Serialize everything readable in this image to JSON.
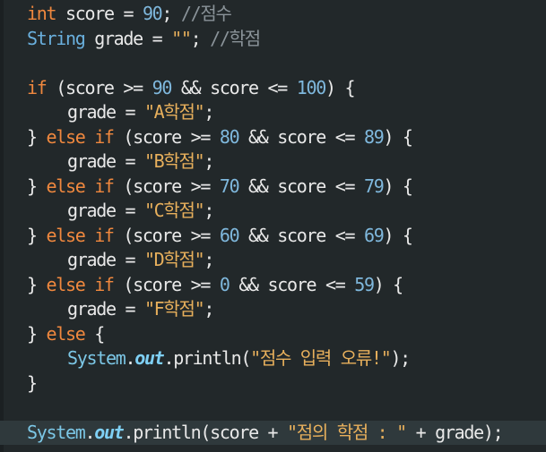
{
  "code": {
    "lines": [
      {
        "indent": 0,
        "tokens": [
          {
            "t": "kw",
            "v": "int"
          },
          {
            "t": "op",
            "v": " "
          },
          {
            "t": "var",
            "v": "score"
          },
          {
            "t": "op",
            "v": " = "
          },
          {
            "t": "num",
            "v": "90"
          },
          {
            "t": "op",
            "v": "; "
          },
          {
            "t": "cmt",
            "v": "//점수"
          }
        ]
      },
      {
        "indent": 0,
        "tokens": [
          {
            "t": "type",
            "v": "String"
          },
          {
            "t": "op",
            "v": " "
          },
          {
            "t": "var",
            "v": "grade"
          },
          {
            "t": "op",
            "v": " = "
          },
          {
            "t": "str",
            "v": "\"\""
          },
          {
            "t": "op",
            "v": "; "
          },
          {
            "t": "cmt",
            "v": "//학점"
          }
        ]
      },
      {
        "indent": 0,
        "tokens": []
      },
      {
        "indent": 0,
        "tokens": [
          {
            "t": "kw",
            "v": "if"
          },
          {
            "t": "op",
            "v": " (score >= "
          },
          {
            "t": "num",
            "v": "90"
          },
          {
            "t": "op",
            "v": " && score <= "
          },
          {
            "t": "num",
            "v": "100"
          },
          {
            "t": "op",
            "v": ") {"
          }
        ]
      },
      {
        "indent": 1,
        "tokens": [
          {
            "t": "var",
            "v": "grade = "
          },
          {
            "t": "str",
            "v": "\"A학점\""
          },
          {
            "t": "op",
            "v": ";"
          }
        ]
      },
      {
        "indent": 0,
        "tokens": [
          {
            "t": "op",
            "v": "} "
          },
          {
            "t": "kw",
            "v": "else if"
          },
          {
            "t": "op",
            "v": " (score >= "
          },
          {
            "t": "num",
            "v": "80"
          },
          {
            "t": "op",
            "v": " && score <= "
          },
          {
            "t": "num",
            "v": "89"
          },
          {
            "t": "op",
            "v": ") {"
          }
        ]
      },
      {
        "indent": 1,
        "tokens": [
          {
            "t": "var",
            "v": "grade = "
          },
          {
            "t": "str",
            "v": "\"B학점\""
          },
          {
            "t": "op",
            "v": ";"
          }
        ]
      },
      {
        "indent": 0,
        "tokens": [
          {
            "t": "op",
            "v": "} "
          },
          {
            "t": "kw",
            "v": "else if"
          },
          {
            "t": "op",
            "v": " (score >= "
          },
          {
            "t": "num",
            "v": "70"
          },
          {
            "t": "op",
            "v": " && score <= "
          },
          {
            "t": "num",
            "v": "79"
          },
          {
            "t": "op",
            "v": ") {"
          }
        ]
      },
      {
        "indent": 1,
        "tokens": [
          {
            "t": "var",
            "v": "grade = "
          },
          {
            "t": "str",
            "v": "\"C학점\""
          },
          {
            "t": "op",
            "v": ";"
          }
        ]
      },
      {
        "indent": 0,
        "tokens": [
          {
            "t": "op",
            "v": "} "
          },
          {
            "t": "kw",
            "v": "else if"
          },
          {
            "t": "op",
            "v": " (score >= "
          },
          {
            "t": "num",
            "v": "60"
          },
          {
            "t": "op",
            "v": " && score <= "
          },
          {
            "t": "num",
            "v": "69"
          },
          {
            "t": "op",
            "v": ") {"
          }
        ]
      },
      {
        "indent": 1,
        "tokens": [
          {
            "t": "var",
            "v": "grade = "
          },
          {
            "t": "str",
            "v": "\"D학점\""
          },
          {
            "t": "op",
            "v": ";"
          }
        ]
      },
      {
        "indent": 0,
        "tokens": [
          {
            "t": "op",
            "v": "} "
          },
          {
            "t": "kw",
            "v": "else if"
          },
          {
            "t": "op",
            "v": " (score >= "
          },
          {
            "t": "num",
            "v": "0"
          },
          {
            "t": "op",
            "v": " && score <= "
          },
          {
            "t": "num",
            "v": "59"
          },
          {
            "t": "op",
            "v": ") {"
          }
        ]
      },
      {
        "indent": 1,
        "tokens": [
          {
            "t": "var",
            "v": "grade = "
          },
          {
            "t": "str",
            "v": "\"F학점\""
          },
          {
            "t": "op",
            "v": ";"
          }
        ]
      },
      {
        "indent": 0,
        "tokens": [
          {
            "t": "op",
            "v": "} "
          },
          {
            "t": "kw",
            "v": "else"
          },
          {
            "t": "op",
            "v": " {"
          }
        ]
      },
      {
        "indent": 1,
        "tokens": [
          {
            "t": "cls",
            "v": "System"
          },
          {
            "t": "op",
            "v": "."
          },
          {
            "t": "fld",
            "v": "out"
          },
          {
            "t": "op",
            "v": "."
          },
          {
            "t": "mth",
            "v": "println"
          },
          {
            "t": "op",
            "v": "("
          },
          {
            "t": "str",
            "v": "\"점수 입력 오류!\""
          },
          {
            "t": "op",
            "v": ");"
          }
        ]
      },
      {
        "indent": 0,
        "tokens": [
          {
            "t": "op",
            "v": "}"
          }
        ]
      },
      {
        "indent": 0,
        "tokens": []
      },
      {
        "indent": 0,
        "current": true,
        "tokens": [
          {
            "t": "cls",
            "v": "System"
          },
          {
            "t": "op",
            "v": "."
          },
          {
            "t": "fld",
            "v": "out"
          },
          {
            "t": "op",
            "v": "."
          },
          {
            "t": "mth",
            "v": "println"
          },
          {
            "t": "op",
            "v": "(score + "
          },
          {
            "t": "str",
            "v": "\"점의 학점 : \""
          },
          {
            "t": "op",
            "v": " + grade);"
          }
        ]
      }
    ]
  },
  "colors": {
    "background": "#22282a",
    "current_line": "#2f393c",
    "keyword": "#f0883e",
    "type": "#6ab0de",
    "number": "#7fb8dd",
    "string": "#e8b05c",
    "comment": "#8a9399",
    "field": "#7fd0f5",
    "text": "#e9e9e9"
  }
}
